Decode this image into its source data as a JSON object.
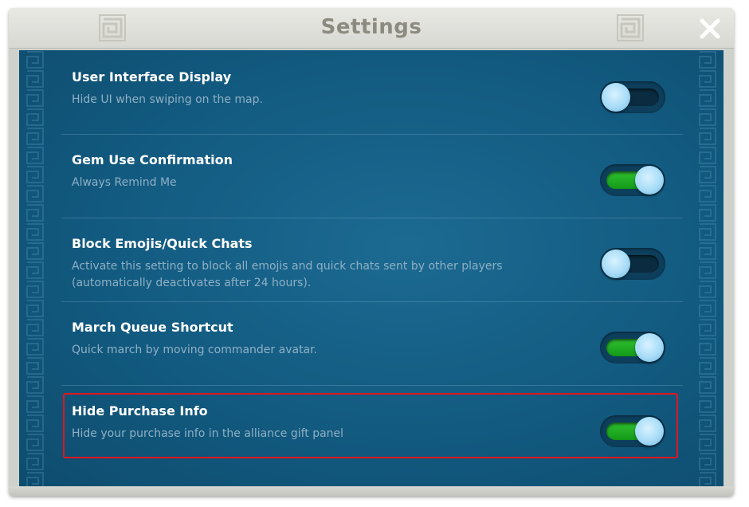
{
  "window": {
    "title": "Settings",
    "close_icon": "close-icon"
  },
  "settings": [
    {
      "title": "User Interface Display",
      "description": "Hide UI when swiping on the map.",
      "enabled": false
    },
    {
      "title": "Gem Use Confirmation",
      "description": "Always Remind Me",
      "enabled": true
    },
    {
      "title": "Block Emojis/Quick Chats",
      "description": "Activate this setting to block all emojis and quick chats sent by other players (automatically deactivates after 24 hours).",
      "enabled": false
    },
    {
      "title": "March Queue Shortcut",
      "description": "Quick march by moving commander avatar.",
      "enabled": true
    },
    {
      "title": "Hide Purchase Info",
      "description": "Hide your purchase info in the alliance gift panel",
      "enabled": true,
      "highlighted": true
    }
  ],
  "colors": {
    "panel": "#125a80",
    "toggle_on": "#22b022",
    "highlight_border": "#e0161e"
  }
}
